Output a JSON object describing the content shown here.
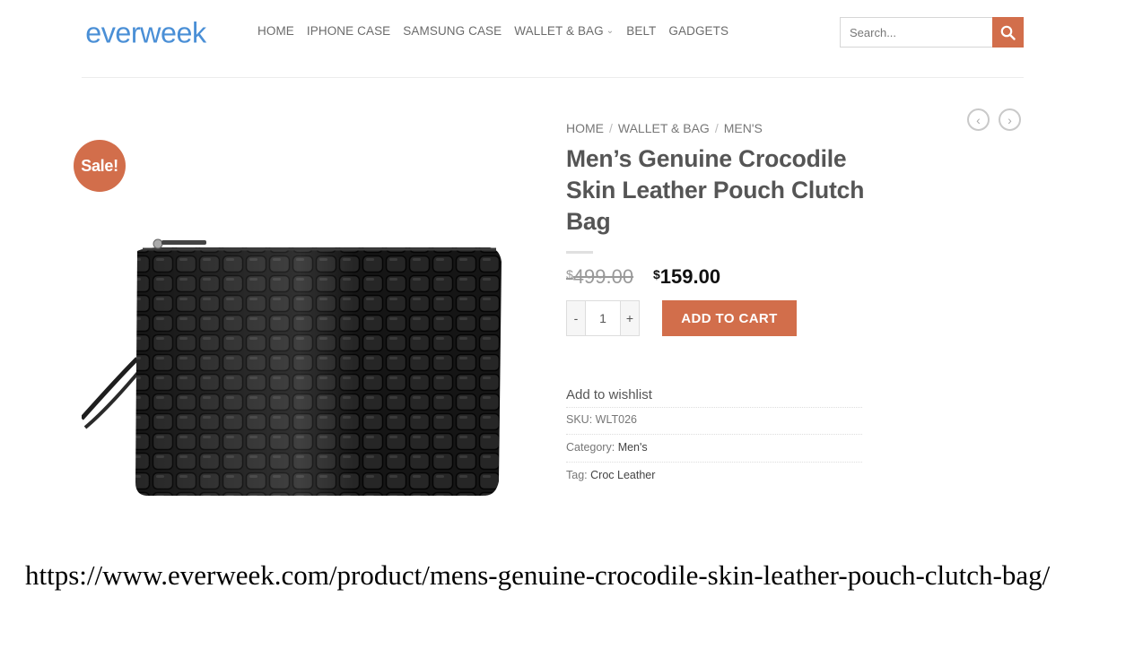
{
  "header": {
    "logo_text": "everweek",
    "nav": [
      {
        "label": "HOME"
      },
      {
        "label": "IPHONE CASE"
      },
      {
        "label": "SAMSUNG CASE"
      },
      {
        "label": "WALLET & BAG"
      },
      {
        "label": "BELT"
      },
      {
        "label": "GADGETS"
      }
    ],
    "search": {
      "placeholder": "Search..."
    }
  },
  "product": {
    "sale_badge": "Sale!",
    "breadcrumb": [
      "HOME",
      "WALLET & BAG",
      "MEN'S"
    ],
    "breadcrumb_separator": "/",
    "title": "Men’s Genuine Crocodile Skin Leather Pouch Clutch Bag",
    "currency_symbol": "$",
    "price_old": "499.00",
    "price_new": "159.00",
    "quantity": "1",
    "qty_minus": "-",
    "qty_plus": "+",
    "add_to_cart": "ADD TO CART",
    "wishlist": "Add to wishlist",
    "sku_label": "SKU:",
    "sku_value": "WLT026",
    "category_label": "Category:",
    "category_value": "Men's",
    "tag_label": "Tag:",
    "tag_value": "Croc Leather"
  },
  "pager": {
    "prev_icon": "chevron-left-icon",
    "next_icon": "chevron-right-icon"
  },
  "caption": {
    "url": "https://www.everweek.com/product/mens-genuine-crocodile-skin-leather-pouch-clutch-bag/"
  },
  "colors": {
    "accent": "#d26e4b",
    "logo": "#4a8fd6",
    "nav_text": "#6b6b6b"
  }
}
